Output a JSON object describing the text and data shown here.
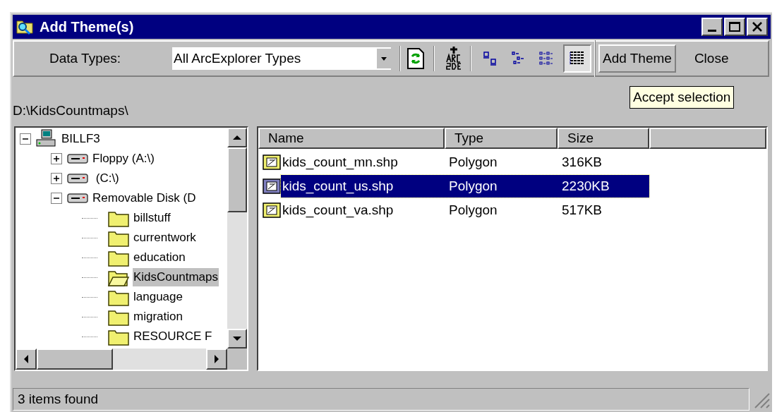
{
  "window": {
    "title": "Add Theme(s)"
  },
  "toolbar": {
    "data_types_label": "Data Types:",
    "data_types_value": "All ArcExplorer Types",
    "view_buttons": [
      {
        "selected": false
      },
      {
        "selected": false
      },
      {
        "selected": false
      },
      {
        "selected": true
      }
    ],
    "buttons": [
      "Add Theme",
      "Close"
    ]
  },
  "tooltip": "Accept selection",
  "path": "D:\\KidsCountmaps\\",
  "tree": [
    {
      "label": "BILLF3",
      "kind": "computer",
      "expanded": true,
      "selected": false,
      "children": [
        {
          "label": "Floppy (A:\\)",
          "kind": "drive",
          "expanded": false,
          "selected": false
        },
        {
          "label": " (C:\\)",
          "kind": "drive",
          "expanded": false,
          "selected": false
        },
        {
          "label": "Removable Disk (D",
          "kind": "drive",
          "expanded": true,
          "selected": false,
          "children": [
            {
              "label": "billstuff",
              "kind": "folder",
              "selected": false
            },
            {
              "label": "currentwork",
              "kind": "folder",
              "selected": false
            },
            {
              "label": "education",
              "kind": "folder",
              "selected": false
            },
            {
              "label": "KidsCountmaps",
              "kind": "folder",
              "selected": true
            },
            {
              "label": "language",
              "kind": "folder",
              "selected": false
            },
            {
              "label": "migration",
              "kind": "folder",
              "selected": false
            },
            {
              "label": "RESOURCE F",
              "kind": "folder",
              "selected": false
            }
          ]
        }
      ]
    }
  ],
  "table": {
    "columns": [
      "Name",
      "Type",
      "Size"
    ],
    "rows": [
      {
        "name": "kids_count_mn.shp",
        "type": "Polygon",
        "size": "316KB",
        "selected": false
      },
      {
        "name": "kids_count_us.shp",
        "type": "Polygon",
        "size": "2230KB",
        "selected": true
      },
      {
        "name": "kids_count_va.shp",
        "type": "Polygon",
        "size": "517KB",
        "selected": false
      }
    ]
  },
  "status_bar": "3 items found"
}
